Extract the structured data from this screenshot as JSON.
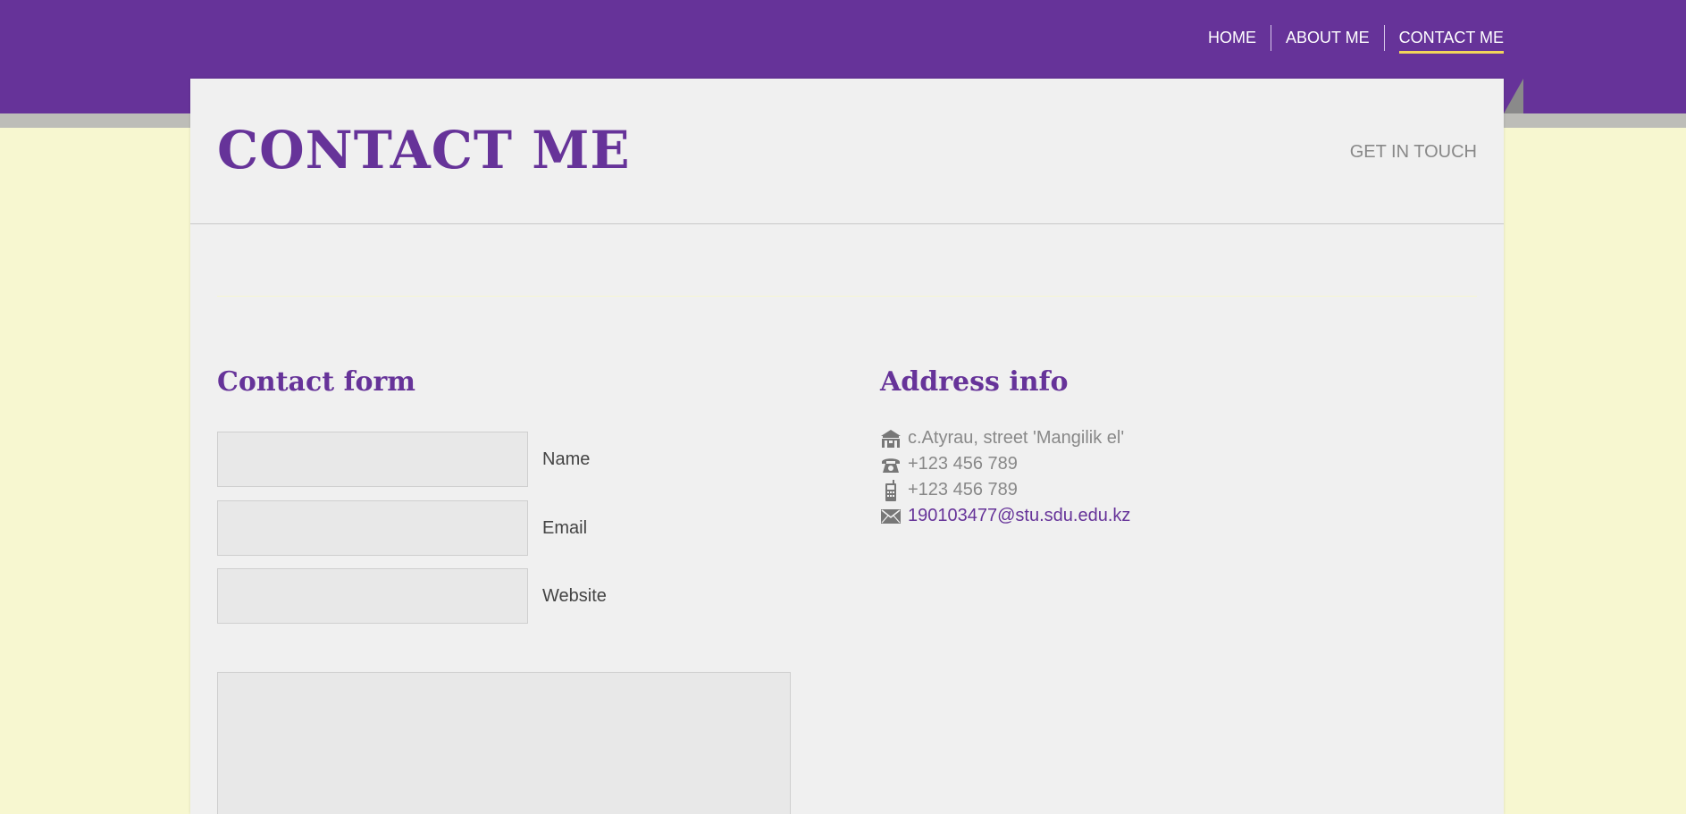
{
  "colors": {
    "brand": "#663399",
    "background": "#f7f7d0",
    "panel": "#f0f0f0",
    "nav_active_underline": "#f2d65a"
  },
  "nav": {
    "items": [
      {
        "label": "HOME",
        "active": false
      },
      {
        "label": "ABOUT ME",
        "active": false
      },
      {
        "label": "CONTACT ME",
        "active": true
      }
    ]
  },
  "header": {
    "title": "CONTACT ME",
    "tagline": "GET IN TOUCH"
  },
  "contact_form": {
    "title": "Contact form",
    "fields": [
      {
        "label": "Name",
        "value": ""
      },
      {
        "label": "Email",
        "value": ""
      },
      {
        "label": "Website",
        "value": ""
      }
    ],
    "message_value": ""
  },
  "address_info": {
    "title": "Address info",
    "items": [
      {
        "icon": "home-icon",
        "text": "c.Atyrau, street 'Mangilik el'"
      },
      {
        "icon": "phone-icon",
        "text": "+123 456 789"
      },
      {
        "icon": "mobile-icon",
        "text": "+123 456 789"
      },
      {
        "icon": "mail-icon",
        "text": "190103477@stu.sdu.edu.kz"
      }
    ]
  }
}
